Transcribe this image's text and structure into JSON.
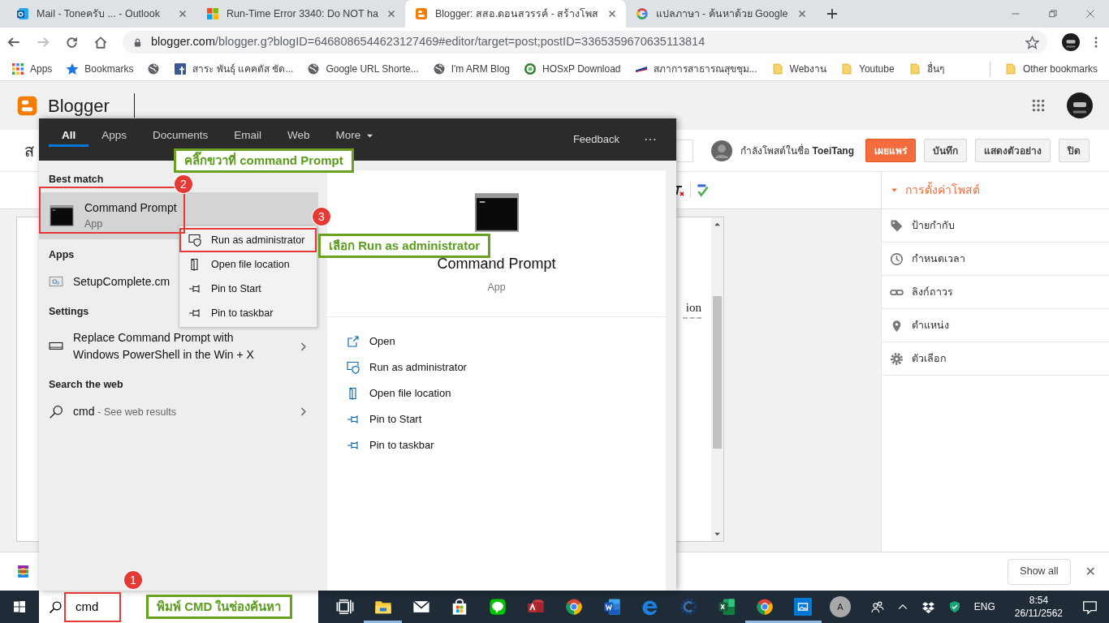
{
  "browser": {
    "tabs": [
      {
        "kind": "outlook",
        "title": "Mail - Toneครับ ... - Outlook",
        "selected": false
      },
      {
        "kind": "windows",
        "title": "Run-Time Error 3340: Do NOT ha",
        "selected": false
      },
      {
        "kind": "blogger",
        "title": "Blogger: สสอ.ดอนสวรรค์ - สร้างโพส",
        "selected": true
      },
      {
        "kind": "google",
        "title": "แปลภาษา - ค้นหาด้วย Google",
        "selected": false
      }
    ],
    "address": {
      "host": "blogger.com",
      "path": "/blogger.g?blogID=6468086544623127469#editor/target=post;postID=3365359670635113814"
    },
    "bookmarks": [
      {
        "kind": "apps",
        "label": "Apps"
      },
      {
        "kind": "star",
        "label": "Bookmarks"
      },
      {
        "kind": "globe"
      },
      {
        "kind": "facebook",
        "label": "สาระ พันธุ์ แคคตัส ชัด..."
      },
      {
        "kind": "globe",
        "label": "Google URL Shorte..."
      },
      {
        "kind": "globe",
        "label": "I'm ARM Blog"
      },
      {
        "kind": "hosxp",
        "label": "HOSxP Download"
      },
      {
        "kind": "flag",
        "label": "สภาการสาธารณสุขชุม..."
      },
      {
        "kind": "folder",
        "label": "Webงาน"
      },
      {
        "kind": "folder",
        "label": "Youtube"
      },
      {
        "kind": "folder",
        "label": "อื่นๆ"
      }
    ],
    "other_bookmarks": "Other bookmarks"
  },
  "blogger": {
    "brand": "Blogger",
    "post_title": "ส",
    "author_line": "กำลังโพสต์ในชื่อ **ToeiTang**",
    "buttons": [
      {
        "kind": "primary",
        "label": "เผยแพร่"
      },
      {
        "kind": "default",
        "label": "บันทึก"
      },
      {
        "kind": "default",
        "label": "แสดงตัวอย่าง"
      },
      {
        "kind": "default",
        "label": "ปิด"
      }
    ],
    "editor_text": "ion",
    "settings": {
      "title": "การตั้งค่าโพสต์",
      "expanded": true,
      "items": [
        {
          "kind": "tag",
          "label": "ป้ายกำกับ"
        },
        {
          "kind": "clock",
          "label": "กำหนดเวลา"
        },
        {
          "kind": "link",
          "label": "ลิงก์ถาวร"
        },
        {
          "kind": "pin",
          "label": "ตำแหน่ง"
        },
        {
          "kind": "gear",
          "label": "ตัวเลือก"
        }
      ]
    }
  },
  "download_bar": {
    "button": "Show all",
    "close": "✕"
  },
  "start_search": {
    "tabs": [
      {
        "label": "All",
        "selected": true
      },
      {
        "label": "Apps",
        "selected": false
      },
      {
        "label": "Documents",
        "selected": false
      },
      {
        "label": "Email",
        "selected": false
      },
      {
        "label": "Web",
        "selected": false
      },
      {
        "label": "More",
        "selected": false,
        "has_menu": true
      }
    ],
    "feedback": "Feedback",
    "more_options": "···",
    "groups": [
      {
        "heading": "Best match",
        "items": [
          {
            "kind": "cmd",
            "title": "Command Prompt",
            "subtitle": "App",
            "selected": true
          }
        ]
      },
      {
        "heading": "Apps",
        "items": [
          {
            "kind": "script",
            "title": "SetupComplete.cm",
            "selected": false
          }
        ]
      },
      {
        "heading": "Settings",
        "items": [
          {
            "kind": "display",
            "title": "Replace Command Prompt with Windows PowerShell in the Win + X",
            "selected": false,
            "chevron": true
          }
        ]
      },
      {
        "heading": "Search the web",
        "items": [
          {
            "kind": "web",
            "title": "cmd",
            "note": "- See web results",
            "selected": false,
            "chevron": true
          }
        ]
      }
    ],
    "preview": {
      "title": "Command Prompt",
      "subtitle": "App",
      "actions": [
        {
          "kind": "open",
          "label": "Open"
        },
        {
          "kind": "admin",
          "label": "Run as administrator"
        },
        {
          "kind": "folder",
          "label": "Open file location"
        },
        {
          "kind": "pin",
          "label": "Pin to Start"
        },
        {
          "kind": "pin",
          "label": "Pin to taskbar"
        }
      ]
    },
    "context_menu": [
      {
        "kind": "admin",
        "label": "Run as administrator",
        "framed": true
      },
      {
        "kind": "folder",
        "label": "Open file location",
        "framed": false
      },
      {
        "kind": "pin",
        "label": "Pin to Start",
        "framed": false
      },
      {
        "kind": "pin",
        "label": "Pin to taskbar",
        "framed": false
      }
    ]
  },
  "annotations": {
    "callouts": [
      "คลิ๊กขวาที่ command Prompt",
      "เลือก Run as administrator",
      "พิมพ์ CMD ในช่องค้นหา"
    ],
    "steps": [
      "1",
      "2",
      "3"
    ]
  },
  "taskbar": {
    "search_value": "cmd",
    "apps": [
      {
        "kind": "taskview",
        "running": false
      },
      {
        "kind": "explorer",
        "running": true
      },
      {
        "kind": "mail",
        "running": false
      },
      {
        "kind": "store",
        "running": false
      },
      {
        "kind": "line",
        "running": false
      },
      {
        "kind": "access",
        "running": false
      },
      {
        "kind": "chrome",
        "running": false
      },
      {
        "kind": "word",
        "running": false
      },
      {
        "kind": "edge",
        "running": false
      },
      {
        "kind": "cheat",
        "running": false
      },
      {
        "kind": "excel",
        "running": false
      },
      {
        "kind": "chrome",
        "running": true
      },
      {
        "kind": "photos",
        "running": true
      }
    ],
    "tray": {
      "user_initial": "A",
      "language": "ENG",
      "time": "8:54",
      "date": "26/11/2562"
    }
  }
}
